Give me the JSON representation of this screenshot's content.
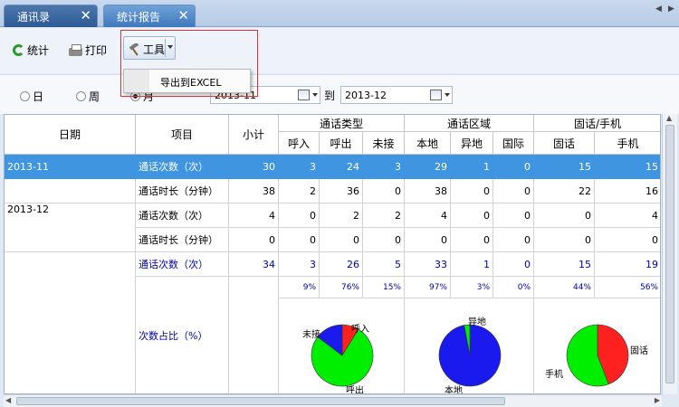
{
  "tabs": [
    {
      "label": "通讯录"
    },
    {
      "label": "统计报告"
    }
  ],
  "toolbar": {
    "stats": "统计",
    "print": "打印",
    "tools": "工具",
    "export": "导出到EXCEL"
  },
  "filter": {
    "day": "日",
    "week": "周",
    "month": "月",
    "to": "到",
    "from_value": "2013-11",
    "to_value": "2013-12"
  },
  "headers": {
    "date": "日期",
    "item": "项目",
    "subtotal": "小计",
    "call_type": "通话类型",
    "call_area": "通话区域",
    "phone_kind": "固话/手机",
    "sub": [
      "呼入",
      "呼出",
      "未接",
      "本地",
      "异地",
      "国际",
      "固话",
      "手机"
    ]
  },
  "rows": [
    {
      "date": "2013-11",
      "item": "通话次数（次）",
      "vals": [
        "30",
        "3",
        "24",
        "3",
        "29",
        "1",
        "0",
        "15",
        "15"
      ]
    },
    {
      "date": "",
      "item": "通话时长（分钟）",
      "vals": [
        "38",
        "2",
        "36",
        "0",
        "38",
        "0",
        "0",
        "22",
        "16"
      ]
    },
    {
      "date": "2013-12",
      "item": "通话次数（次）",
      "vals": [
        "4",
        "0",
        "2",
        "2",
        "4",
        "0",
        "0",
        "0",
        "4"
      ]
    },
    {
      "date": "",
      "item": "通话时长（分钟）",
      "vals": [
        "0",
        "0",
        "0",
        "0",
        "0",
        "0",
        "0",
        "0",
        "0"
      ]
    }
  ],
  "total": {
    "item": "通话次数（次）",
    "vals": [
      "34",
      "3",
      "26",
      "5",
      "33",
      "1",
      "0",
      "15",
      "19"
    ]
  },
  "percent": {
    "item": "次数占比（%）",
    "vals": [
      "9%",
      "76%",
      "15%",
      "97%",
      "3%",
      "0%",
      "44%",
      "56%"
    ]
  },
  "chart_data": [
    {
      "type": "pie",
      "labels": [
        "呼入",
        "呼出",
        "未接"
      ],
      "values": [
        3,
        26,
        5
      ],
      "colors": [
        "#ff2020",
        "#00ee00",
        "#1a1aee"
      ]
    },
    {
      "type": "pie",
      "labels": [
        "本地",
        "异地",
        "国际"
      ],
      "values": [
        33,
        1,
        0
      ],
      "colors": [
        "#1a1aee",
        "#00ee00",
        "#ff2020"
      ]
    },
    {
      "type": "pie",
      "labels": [
        "固话",
        "手机"
      ],
      "values": [
        15,
        19
      ],
      "colors": [
        "#ff2020",
        "#00ee00"
      ]
    }
  ],
  "pie_labels": {
    "p1": [
      "未接",
      "呼入",
      "呼出"
    ],
    "p2": [
      "异地",
      "本地"
    ],
    "p3": [
      "固话",
      "手机"
    ]
  }
}
